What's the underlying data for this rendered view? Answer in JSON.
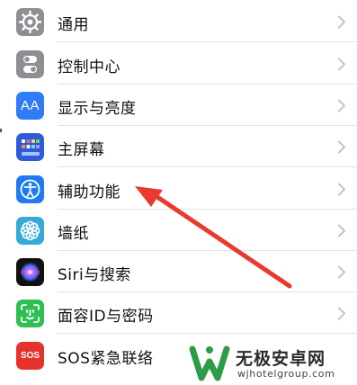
{
  "settings": {
    "items": [
      {
        "label": "通用",
        "icon": "gear-icon",
        "icon_color": "#8e8e93"
      },
      {
        "label": "控制中心",
        "icon": "toggle-switches-icon",
        "icon_color": "#8e8e93"
      },
      {
        "label": "显示与亮度",
        "icon": "text-size-aa-icon",
        "icon_color": "#2f7cf6",
        "icon_text": "AA"
      },
      {
        "label": "主屏幕",
        "icon": "home-grid-icon",
        "icon_color": "#2e5bd8"
      },
      {
        "label": "辅助功能",
        "icon": "accessibility-person-icon",
        "icon_color": "#1f7bf2"
      },
      {
        "label": "墙纸",
        "icon": "flower-icon",
        "icon_color": "#36a9d8"
      },
      {
        "label": "Siri与搜索",
        "icon": "siri-icon",
        "icon_color": "#111111"
      },
      {
        "label": "面容ID与密码",
        "icon": "face-id-icon",
        "icon_color": "#2fbf55"
      },
      {
        "label": "SOS紧急联络",
        "icon": "sos-icon",
        "icon_color": "#e5332b",
        "icon_text": "SOS"
      }
    ]
  },
  "annotation": {
    "arrow_color": "#e83a33",
    "points_to": "辅助功能"
  },
  "watermark": {
    "title": "无极安卓网",
    "url": "wjhotelgroup.com",
    "logo_color": "#2f9b48"
  }
}
